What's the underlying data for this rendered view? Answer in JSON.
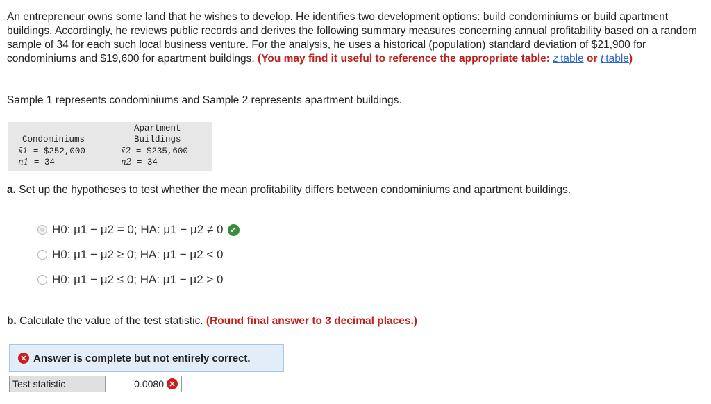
{
  "intro": {
    "text": "An entrepreneur owns some land that he wishes to develop. He identifies two development options: build condominiums or build apartment buildings. Accordingly, he reviews public records and derives  the following summary measures concerning annual profitability based on a random sample of 34 for each such local business venture. For the analysis, he uses a historical (population) standard deviation of $21,900 for condominiums and $19,600 for apartment buildings.",
    "hint_prefix": "(You may find it useful to reference the appropriate table:",
    "z_link_var": "z",
    "z_link_text": "table",
    "or_text": "or",
    "t_link_var": "t",
    "t_link_text": "table",
    "hint_suffix": ")"
  },
  "sample_note": "Sample 1 represents condominiums and Sample 2 represents apartment buildings.",
  "table": {
    "col1_header": "Condominiums",
    "col2_header_line1": "Apartment",
    "col2_header_line2": "Buildings",
    "x1_sym": "x̄1",
    "x1_value": " = $252,000",
    "n1_sym": "n1",
    "n1_value": " = 34",
    "x2_sym": "x̄2",
    "x2_value": " = $235,600",
    "n2_sym": "n2",
    "n2_value": " = 34"
  },
  "part_a": {
    "label": "a.",
    "question": "Set up the hypotheses to test whether the mean profitability differs between condominiums and apartment buildings.",
    "options": [
      {
        "text": "H0: μ1 − μ2 = 0; HA: μ1 − μ2 ≠ 0",
        "selected": true,
        "correct": true
      },
      {
        "text": "H0: μ1 − μ2 ≥ 0; HA: μ1 − μ2 < 0",
        "selected": false
      },
      {
        "text": "H0: μ1 − μ2 ≤ 0; HA: μ1 − μ2 > 0",
        "selected": false
      }
    ]
  },
  "part_b": {
    "label": "b.",
    "question": "Calculate the value of the test statistic.",
    "instruction": "(Round final answer to 3 decimal places.)"
  },
  "feedback": {
    "message": "Answer is complete but not entirely correct.",
    "status_color": "#c8201e"
  },
  "answer_row": {
    "label": "Test statistic",
    "value": "0.0080"
  },
  "colors": {
    "accent_red": "#c0211c",
    "link_blue": "#2a67c9",
    "correct_green": "#3a8d3a",
    "banner_bg": "#e2edf9"
  }
}
